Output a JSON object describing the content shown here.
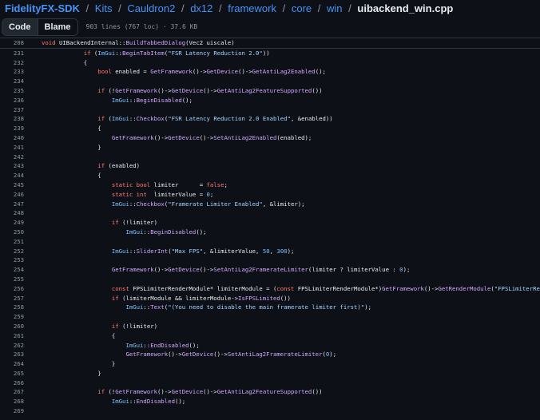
{
  "breadcrumb": {
    "repo": "FidelityFX-SDK",
    "path": [
      "Kits",
      "Cauldron2",
      "dx12",
      "framework",
      "core",
      "win"
    ],
    "file": "uibackend_win.cpp"
  },
  "toolbar": {
    "tabs": [
      "Code",
      "Blame"
    ],
    "active_tab": "Code",
    "file_meta": "903 lines (767 loc) · 37.6 KB"
  },
  "colors": {
    "background": "#0d1117",
    "link": "#4493f8",
    "keyword": "#ff7b72",
    "function": "#d2a8ff",
    "string": "#a5d6ff",
    "line_number": "#8d96a0"
  },
  "sticky_header": {
    "number": "208",
    "tokens": [
      [
        "kw",
        "void "
      ],
      [
        "",
        "UIBackendInternal::"
      ],
      [
        "fn",
        "BuildTabbedDialog"
      ],
      [
        "",
        "(Vec2 uiscale)"
      ]
    ]
  },
  "code_lines": [
    {
      "n": "231",
      "indent": 12,
      "tokens": [
        [
          "kw",
          "if "
        ],
        [
          "",
          "("
        ],
        [
          "cls",
          "ImGui"
        ],
        [
          "",
          "::"
        ],
        [
          "fn",
          "BeginTabItem"
        ],
        [
          "",
          "("
        ],
        [
          "str",
          "\"FSR Latency Reduction 2.0\""
        ],
        [
          "",
          "))"
        ]
      ]
    },
    {
      "n": "232",
      "indent": 12,
      "tokens": [
        [
          "",
          "{"
        ]
      ]
    },
    {
      "n": "233",
      "indent": 16,
      "tokens": [
        [
          "kw",
          "bool "
        ],
        [
          "",
          "enabled = "
        ],
        [
          "fn",
          "GetFramework"
        ],
        [
          "",
          "()->"
        ],
        [
          "fn",
          "GetDevice"
        ],
        [
          "",
          "()->"
        ],
        [
          "fn",
          "GetAntiLag2Enabled"
        ],
        [
          "",
          "();"
        ]
      ]
    },
    {
      "n": "234",
      "indent": 0,
      "tokens": []
    },
    {
      "n": "235",
      "indent": 16,
      "tokens": [
        [
          "kw",
          "if "
        ],
        [
          "",
          "(!"
        ],
        [
          "fn",
          "GetFramework"
        ],
        [
          "",
          "()->"
        ],
        [
          "fn",
          "GetDevice"
        ],
        [
          "",
          "()->"
        ],
        [
          "fn",
          "GetAntiLag2FeatureSupported"
        ],
        [
          "",
          "())"
        ]
      ]
    },
    {
      "n": "236",
      "indent": 20,
      "tokens": [
        [
          "cls",
          "ImGui"
        ],
        [
          "",
          "::"
        ],
        [
          "fn",
          "BeginDisabled"
        ],
        [
          "",
          "();"
        ]
      ]
    },
    {
      "n": "237",
      "indent": 0,
      "tokens": []
    },
    {
      "n": "238",
      "indent": 16,
      "tokens": [
        [
          "kw",
          "if "
        ],
        [
          "",
          "("
        ],
        [
          "cls",
          "ImGui"
        ],
        [
          "",
          "::"
        ],
        [
          "fn",
          "Checkbox"
        ],
        [
          "",
          "("
        ],
        [
          "str",
          "\"FSR Latency Reduction 2.0 Enabled\""
        ],
        [
          "",
          ", &enabled))"
        ]
      ]
    },
    {
      "n": "239",
      "indent": 16,
      "tokens": [
        [
          "",
          "{"
        ]
      ]
    },
    {
      "n": "240",
      "indent": 20,
      "tokens": [
        [
          "fn",
          "GetFramework"
        ],
        [
          "",
          "()->"
        ],
        [
          "fn",
          "GetDevice"
        ],
        [
          "",
          "()->"
        ],
        [
          "fn",
          "SetAntiLag2Enabled"
        ],
        [
          "",
          "(enabled);"
        ]
      ]
    },
    {
      "n": "241",
      "indent": 16,
      "tokens": [
        [
          "",
          "}"
        ]
      ]
    },
    {
      "n": "242",
      "indent": 0,
      "tokens": []
    },
    {
      "n": "243",
      "indent": 16,
      "tokens": [
        [
          "kw",
          "if "
        ],
        [
          "",
          "(enabled)"
        ]
      ]
    },
    {
      "n": "244",
      "indent": 16,
      "tokens": [
        [
          "",
          "{"
        ]
      ]
    },
    {
      "n": "245",
      "indent": 20,
      "tokens": [
        [
          "kw",
          "static bool "
        ],
        [
          "",
          "limiter      = "
        ],
        [
          "kw",
          "false"
        ],
        [
          "",
          ";"
        ]
      ]
    },
    {
      "n": "246",
      "indent": 20,
      "tokens": [
        [
          "kw",
          "static int  "
        ],
        [
          "",
          "limiterValue = "
        ],
        [
          "num",
          "0"
        ],
        [
          "",
          ";"
        ]
      ]
    },
    {
      "n": "247",
      "indent": 20,
      "tokens": [
        [
          "cls",
          "ImGui"
        ],
        [
          "",
          "::"
        ],
        [
          "fn",
          "Checkbox"
        ],
        [
          "",
          "("
        ],
        [
          "str",
          "\"Framerate Limiter Enabled\""
        ],
        [
          "",
          ", &limiter);"
        ]
      ]
    },
    {
      "n": "248",
      "indent": 0,
      "tokens": []
    },
    {
      "n": "249",
      "indent": 20,
      "tokens": [
        [
          "kw",
          "if "
        ],
        [
          "",
          "(!limiter)"
        ]
      ]
    },
    {
      "n": "250",
      "indent": 24,
      "tokens": [
        [
          "cls",
          "ImGui"
        ],
        [
          "",
          "::"
        ],
        [
          "fn",
          "BeginDisabled"
        ],
        [
          "",
          "();"
        ]
      ]
    },
    {
      "n": "251",
      "indent": 0,
      "tokens": []
    },
    {
      "n": "252",
      "indent": 20,
      "tokens": [
        [
          "cls",
          "ImGui"
        ],
        [
          "",
          "::"
        ],
        [
          "fn",
          "SliderInt"
        ],
        [
          "",
          "("
        ],
        [
          "str",
          "\"Max FPS\""
        ],
        [
          "",
          ", &limiterValue, "
        ],
        [
          "num",
          "50"
        ],
        [
          "",
          ", "
        ],
        [
          "num",
          "300"
        ],
        [
          "",
          ");"
        ]
      ]
    },
    {
      "n": "253",
      "indent": 0,
      "tokens": []
    },
    {
      "n": "254",
      "indent": 20,
      "tokens": [
        [
          "fn",
          "GetFramework"
        ],
        [
          "",
          "()->"
        ],
        [
          "fn",
          "GetDevice"
        ],
        [
          "",
          "()->"
        ],
        [
          "fn",
          "SetAntiLag2FramerateLimiter"
        ],
        [
          "",
          "(limiter ? limiterValue : "
        ],
        [
          "num",
          "0"
        ],
        [
          "",
          ");"
        ]
      ]
    },
    {
      "n": "255",
      "indent": 0,
      "tokens": []
    },
    {
      "n": "256",
      "indent": 20,
      "tokens": [
        [
          "kw",
          "const "
        ],
        [
          "",
          "FPSLimiterRenderModule* limiterModule = ("
        ],
        [
          "kw",
          "const "
        ],
        [
          "",
          "FPSLimiterRenderModule*)"
        ],
        [
          "fn",
          "GetFramework"
        ],
        [
          "",
          "()->"
        ],
        [
          "fn",
          "GetRenderModule"
        ],
        [
          "",
          "("
        ],
        [
          "str",
          "\"FPSLimiterRenderModule\""
        ],
        [
          "",
          ");"
        ]
      ]
    },
    {
      "n": "257",
      "indent": 20,
      "tokens": [
        [
          "kw",
          "if "
        ],
        [
          "",
          "(limiterModule && limiterModule->"
        ],
        [
          "fn",
          "IsFPSLimited"
        ],
        [
          "",
          "())"
        ]
      ]
    },
    {
      "n": "258",
      "indent": 24,
      "tokens": [
        [
          "cls",
          "ImGui"
        ],
        [
          "",
          "::"
        ],
        [
          "fn",
          "Text"
        ],
        [
          "",
          "("
        ],
        [
          "str",
          "\"(You need to disable the main framerate limiter first)\""
        ],
        [
          "",
          ");"
        ]
      ]
    },
    {
      "n": "259",
      "indent": 0,
      "tokens": []
    },
    {
      "n": "260",
      "indent": 20,
      "tokens": [
        [
          "kw",
          "if "
        ],
        [
          "",
          "(!limiter)"
        ]
      ]
    },
    {
      "n": "261",
      "indent": 20,
      "tokens": [
        [
          "",
          "{"
        ]
      ]
    },
    {
      "n": "262",
      "indent": 24,
      "tokens": [
        [
          "cls",
          "ImGui"
        ],
        [
          "",
          "::"
        ],
        [
          "fn",
          "EndDisabled"
        ],
        [
          "",
          "();"
        ]
      ]
    },
    {
      "n": "263",
      "indent": 24,
      "tokens": [
        [
          "fn",
          "GetFramework"
        ],
        [
          "",
          "()->"
        ],
        [
          "fn",
          "GetDevice"
        ],
        [
          "",
          "()->"
        ],
        [
          "fn",
          "SetAntiLag2FramerateLimiter"
        ],
        [
          "",
          "("
        ],
        [
          "num",
          "0"
        ],
        [
          "",
          ");"
        ]
      ]
    },
    {
      "n": "264",
      "indent": 20,
      "tokens": [
        [
          "",
          "}"
        ]
      ]
    },
    {
      "n": "265",
      "indent": 16,
      "tokens": [
        [
          "",
          "}"
        ]
      ]
    },
    {
      "n": "266",
      "indent": 0,
      "tokens": []
    },
    {
      "n": "267",
      "indent": 16,
      "tokens": [
        [
          "kw",
          "if "
        ],
        [
          "",
          "(!"
        ],
        [
          "fn",
          "GetFramework"
        ],
        [
          "",
          "()->"
        ],
        [
          "fn",
          "GetDevice"
        ],
        [
          "",
          "()->"
        ],
        [
          "fn",
          "GetAntiLag2FeatureSupported"
        ],
        [
          "",
          "())"
        ]
      ]
    },
    {
      "n": "268",
      "indent": 20,
      "tokens": [
        [
          "cls",
          "ImGui"
        ],
        [
          "",
          "::"
        ],
        [
          "fn",
          "EndDisabled"
        ],
        [
          "",
          "();"
        ]
      ]
    },
    {
      "n": "269",
      "indent": 0,
      "tokens": []
    }
  ]
}
